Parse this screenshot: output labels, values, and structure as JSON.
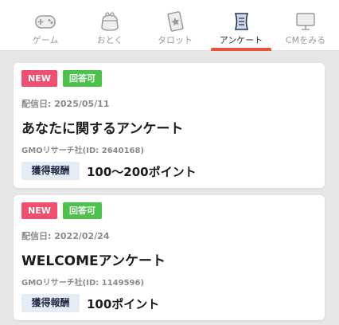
{
  "tabs": [
    {
      "label": "ゲーム",
      "icon": "game-controller-icon",
      "active": false
    },
    {
      "label": "おとく",
      "icon": "coin-purse-icon",
      "active": false
    },
    {
      "label": "タロット",
      "icon": "tarot-card-icon",
      "active": false
    },
    {
      "label": "アンケート",
      "icon": "survey-scroll-icon",
      "active": true
    },
    {
      "label": "CMをみる",
      "icon": "monitor-icon",
      "active": false
    }
  ],
  "colors": {
    "accent": "#e8553a",
    "badge_new": "#f04f6f",
    "badge_answerable": "#4cc24a",
    "reward_label_bg": "#e6ecf5"
  },
  "surveys": [
    {
      "badge_new": "NEW",
      "badge_status": "回答可",
      "date": "配信日: 2025/05/11",
      "title": "あなたに関するアンケート",
      "company": "GMOリサーチ社(ID: 2640168)",
      "reward_label": "獲得報酬",
      "reward_value": "100〜200ポイント"
    },
    {
      "badge_new": "NEW",
      "badge_status": "回答可",
      "date": "配信日: 2022/02/24",
      "title": "WELCOMEアンケート",
      "company": "GMOリサーチ社(ID: 1149596)",
      "reward_label": "獲得報酬",
      "reward_value": "100ポイント"
    }
  ]
}
